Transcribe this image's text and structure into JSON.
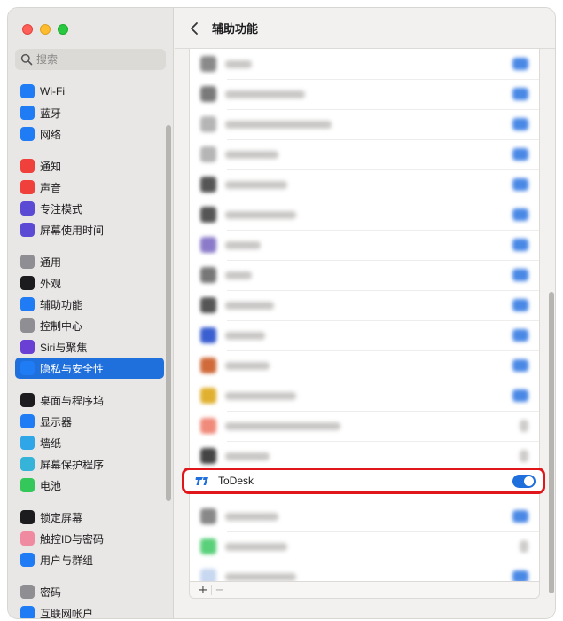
{
  "window": {
    "traffic_lights": [
      "close",
      "minimize",
      "zoom"
    ]
  },
  "sidebar": {
    "search": {
      "placeholder": "搜索",
      "value": ""
    },
    "groups": [
      [
        {
          "label": "Wi-Fi",
          "icon": "wifi-icon",
          "color": "#1f7cf4"
        },
        {
          "label": "蓝牙",
          "icon": "bluetooth-icon",
          "color": "#1f7cf4"
        },
        {
          "label": "网络",
          "icon": "globe-icon",
          "color": "#1f7cf4"
        }
      ],
      [
        {
          "label": "通知",
          "icon": "bell-icon",
          "color": "#f0403b"
        },
        {
          "label": "声音",
          "icon": "speaker-icon",
          "color": "#f0403b"
        },
        {
          "label": "专注模式",
          "icon": "moon-icon",
          "color": "#5b4bd4"
        },
        {
          "label": "屏幕使用时间",
          "icon": "hourglass-icon",
          "color": "#5b4bd4"
        }
      ],
      [
        {
          "label": "通用",
          "icon": "gear-icon",
          "color": "#8e8e93"
        },
        {
          "label": "外观",
          "icon": "appearance-icon",
          "color": "#1c1c1e"
        },
        {
          "label": "辅助功能",
          "icon": "accessibility-icon",
          "color": "#1f7cf4"
        },
        {
          "label": "控制中心",
          "icon": "control-center-icon",
          "color": "#8e8e93"
        },
        {
          "label": "Siri与聚焦",
          "icon": "siri-icon",
          "color": "#6a3fd4"
        },
        {
          "label": "隐私与安全性",
          "icon": "hand-icon",
          "color": "#1f7cf4",
          "active": true
        }
      ],
      [
        {
          "label": "桌面与程序坞",
          "icon": "dock-icon",
          "color": "#1c1c1e"
        },
        {
          "label": "显示器",
          "icon": "sun-icon",
          "color": "#1f7cf4"
        },
        {
          "label": "墙纸",
          "icon": "flower-icon",
          "color": "#2fa6e8"
        },
        {
          "label": "屏幕保护程序",
          "icon": "screensaver-icon",
          "color": "#36b3d8"
        },
        {
          "label": "电池",
          "icon": "battery-icon",
          "color": "#34c759"
        }
      ],
      [
        {
          "label": "锁定屏幕",
          "icon": "lock-icon",
          "color": "#1c1c1e"
        },
        {
          "label": "触控ID与密码",
          "icon": "fingerprint-icon",
          "color": "#f08aa0"
        },
        {
          "label": "用户与群组",
          "icon": "users-icon",
          "color": "#1f7cf4"
        }
      ],
      [
        {
          "label": "密码",
          "icon": "key-icon",
          "color": "#8e8e93"
        },
        {
          "label": "互联网帐户",
          "icon": "at-icon",
          "color": "#1f7cf4"
        }
      ]
    ]
  },
  "main": {
    "title": "辅助功能",
    "rows_blurred": [
      {
        "icon_color": "#8a8a8a",
        "w": 0,
        "on": true
      },
      {
        "icon_color": "#7a7a7a",
        "w": 0,
        "on": true
      },
      {
        "icon_color": "#b5b5b5",
        "w": 0,
        "on": true
      },
      {
        "icon_color": "#b5b5b5",
        "w": 0,
        "on": true
      },
      {
        "icon_color": "#555555",
        "w": 0,
        "on": true
      },
      {
        "icon_color": "#555555",
        "w": 0,
        "on": true
      },
      {
        "icon_color": "#8a7ac9",
        "w": 0,
        "on": true
      },
      {
        "icon_color": "#777777",
        "w": 0,
        "on": true
      },
      {
        "icon_color": "#555555",
        "w": 0,
        "on": true
      },
      {
        "icon_color": "#3a5fd0",
        "w": 0,
        "on": true
      },
      {
        "icon_color": "#d06a3a",
        "w": 0,
        "on": true
      },
      {
        "icon_color": "#e0b030",
        "w": 0,
        "on": true
      },
      {
        "icon_color": "#f08a7a",
        "w": 0,
        "on": false
      },
      {
        "icon_color": "#444444",
        "w": 0,
        "on": false
      }
    ],
    "highlighted_app": {
      "name": "ToDesk",
      "enabled": true
    },
    "rows_after": [
      {
        "icon_color": "#888888",
        "on": true
      },
      {
        "icon_color": "#5ad07a",
        "on": false
      },
      {
        "icon_color": "#c8d8f0",
        "on": true
      }
    ],
    "footer": {
      "add": "+",
      "remove": "−"
    }
  }
}
